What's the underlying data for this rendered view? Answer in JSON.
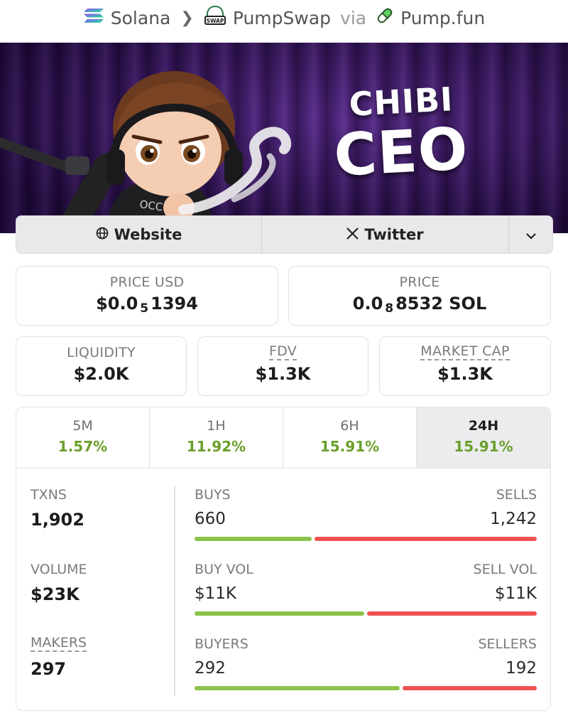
{
  "breadcrumb": {
    "chain": "Solana",
    "dex": "PumpSwap",
    "dex_badge": "SWAP",
    "via": "via",
    "launchpad": "Pump.fun"
  },
  "banner": {
    "title_line1": "CHIBI",
    "title_line2": "CEO",
    "shirt_text": "OCCUPY"
  },
  "links": {
    "website": "Website",
    "twitter": "Twitter"
  },
  "price_usd": {
    "label": "PRICE USD",
    "prefix": "$0.0",
    "zeros": "5",
    "digits": "1394"
  },
  "price_native": {
    "label": "PRICE",
    "prefix": "0.0",
    "zeros": "8",
    "digits": "8532 SOL"
  },
  "liquidity": {
    "label": "LIQUIDITY",
    "value": "$2.0K"
  },
  "fdv": {
    "label": "FDV",
    "value": "$1.3K"
  },
  "market_cap": {
    "label": "MARKET CAP",
    "value": "$1.3K"
  },
  "tabs": [
    {
      "label": "5M",
      "change": "1.57%"
    },
    {
      "label": "1H",
      "change": "11.92%"
    },
    {
      "label": "6H",
      "change": "15.91%"
    },
    {
      "label": "24H",
      "change": "15.91%",
      "active": true
    }
  ],
  "stats": {
    "txns": {
      "label": "TXNS",
      "value": "1,902"
    },
    "volume": {
      "label": "VOLUME",
      "value": "$23K"
    },
    "makers": {
      "label": "MAKERS",
      "value": "297"
    },
    "buys": {
      "label": "BUYS",
      "value": "660",
      "buy_ratio": 0.347
    },
    "sells": {
      "label": "SELLS",
      "value": "1,242"
    },
    "buy_vol": {
      "label": "BUY VOL",
      "value": "$11K",
      "buy_ratio": 0.5
    },
    "sell_vol": {
      "label": "SELL VOL",
      "value": "$11K"
    },
    "buyers": {
      "label": "BUYERS",
      "value": "292",
      "buy_ratio": 0.603
    },
    "sellers": {
      "label": "SELLERS",
      "value": "192"
    }
  },
  "colors": {
    "positive": "#6a9f2a",
    "buy_bar": "#8bc34a",
    "sell_bar": "#ef5350"
  }
}
